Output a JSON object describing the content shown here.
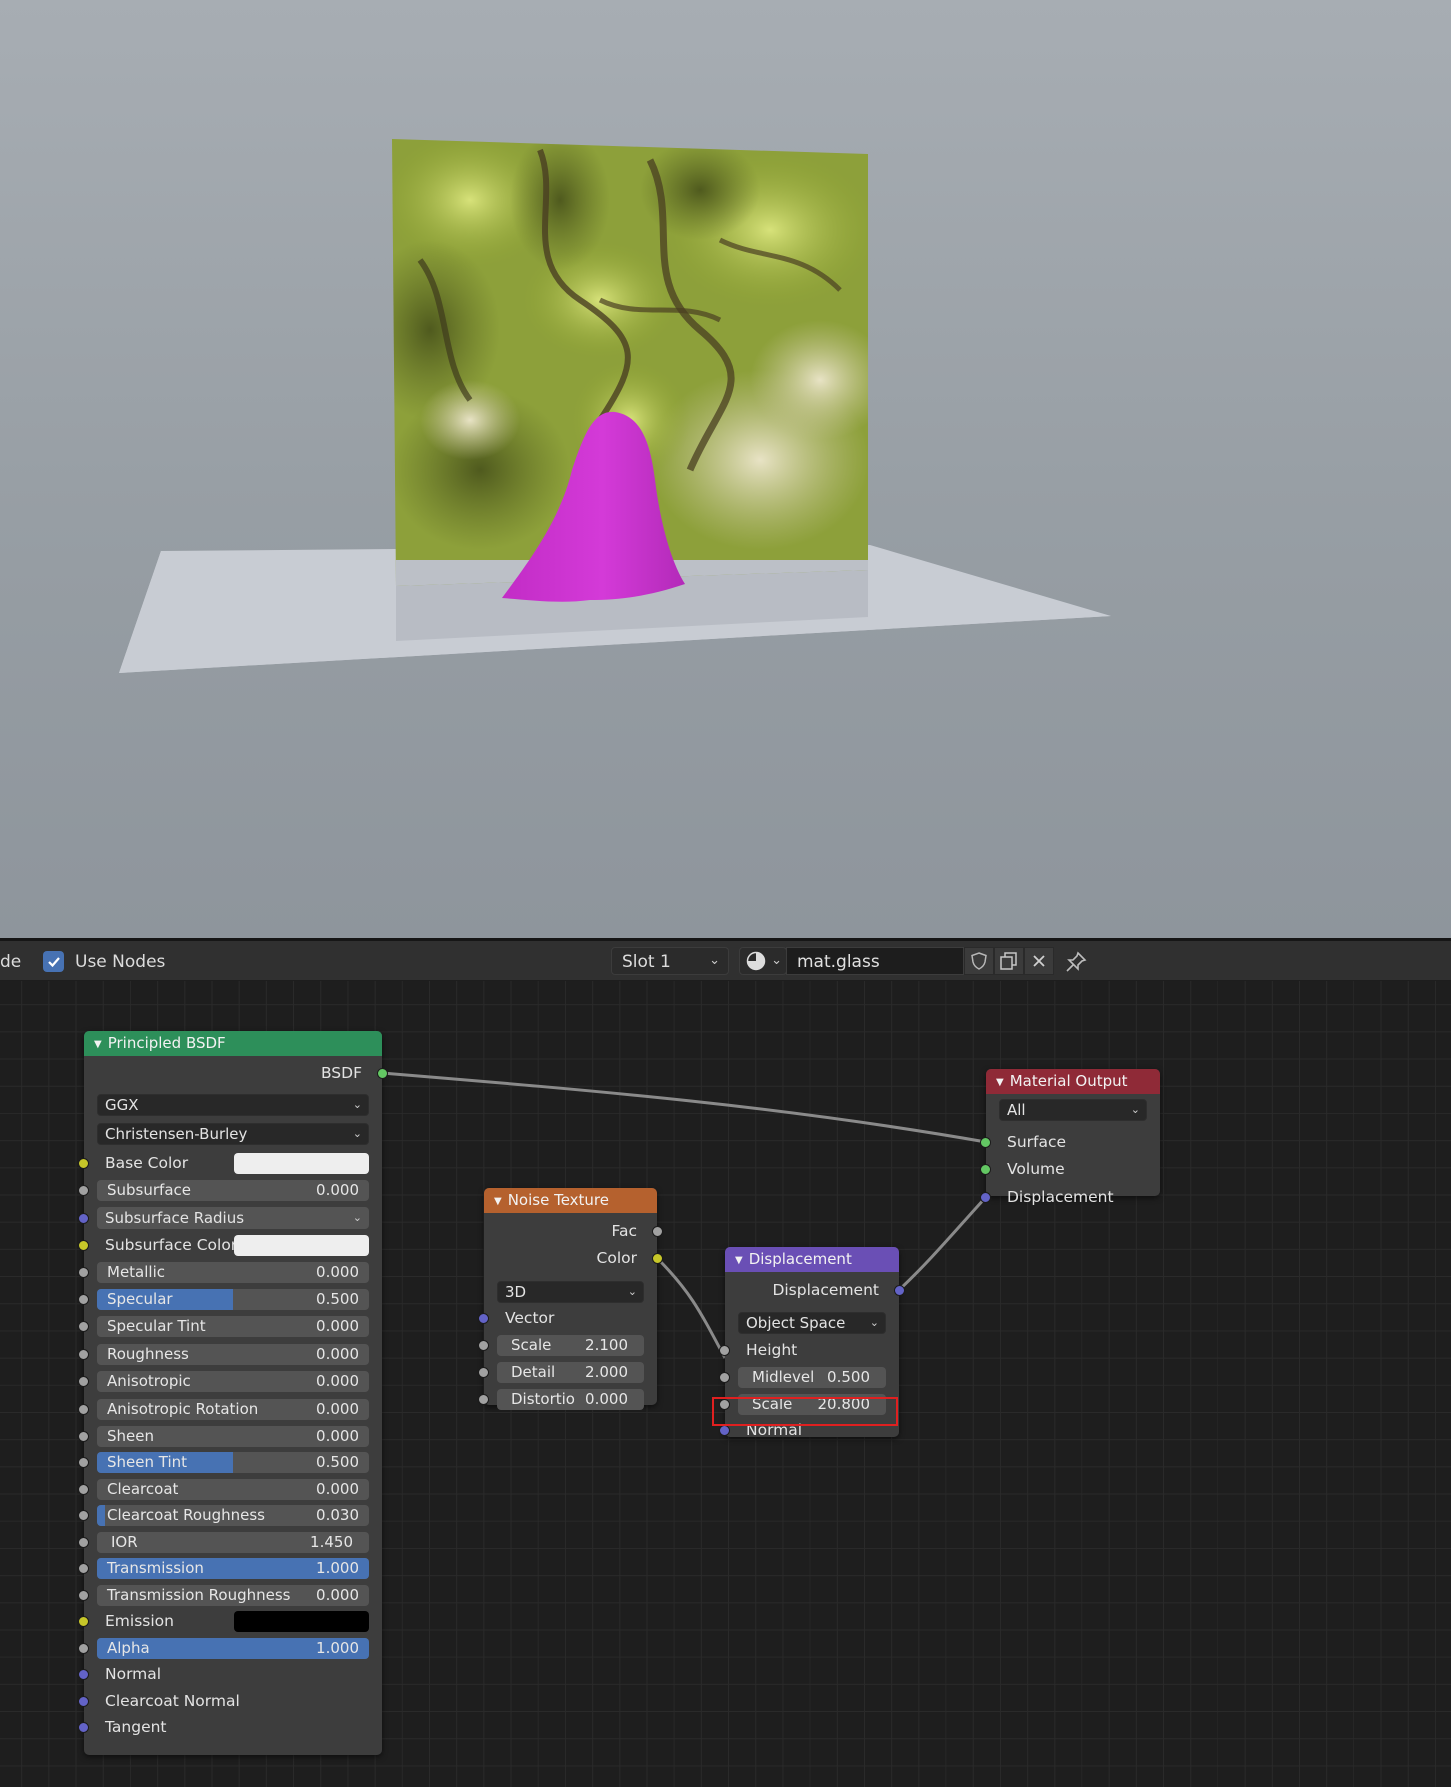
{
  "header": {
    "mode_fragment": "de",
    "use_nodes_label": "Use Nodes",
    "use_nodes_checked": true,
    "slot": "Slot 1",
    "material_name": "mat.glass"
  },
  "nodes": {
    "principled": {
      "title": "Principled BSDF",
      "color": "#2d8f5a",
      "output": "BSDF",
      "distribution": "GGX",
      "subsurface_method": "Christensen-Burley",
      "base_color_label": "Base Color",
      "base_color_value": "#eeeeee",
      "subsurface": {
        "label": "Subsurface",
        "value": "0.000"
      },
      "subsurface_radius": "Subsurface Radius",
      "subsurface_color_label": "Subsurface Color",
      "subsurface_color_value": "#eeeeee",
      "metallic": {
        "label": "Metallic",
        "value": "0.000"
      },
      "specular": {
        "label": "Specular",
        "value": "0.500",
        "fraction": 0.5
      },
      "specular_tint": {
        "label": "Specular Tint",
        "value": "0.000"
      },
      "roughness": {
        "label": "Roughness",
        "value": "0.000"
      },
      "anisotropic": {
        "label": "Anisotropic",
        "value": "0.000"
      },
      "anisotropic_rotation": {
        "label": "Anisotropic Rotation",
        "value": "0.000"
      },
      "sheen": {
        "label": "Sheen",
        "value": "0.000"
      },
      "sheen_tint": {
        "label": "Sheen Tint",
        "value": "0.500",
        "fraction": 0.5
      },
      "clearcoat": {
        "label": "Clearcoat",
        "value": "0.000"
      },
      "clearcoat_roughness": {
        "label": "Clearcoat Roughness",
        "value": "0.030",
        "fraction": 0.03
      },
      "ior": {
        "label": "IOR",
        "value": "1.450"
      },
      "transmission": {
        "label": "Transmission",
        "value": "1.000",
        "fraction": 1.0
      },
      "transmission_roughness": {
        "label": "Transmission Roughness",
        "value": "0.000"
      },
      "emission_label": "Emission",
      "emission_value": "#000000",
      "alpha": {
        "label": "Alpha",
        "value": "1.000",
        "fraction": 1.0
      },
      "normal": "Normal",
      "clearcoat_normal": "Clearcoat Normal",
      "tangent": "Tangent"
    },
    "noise": {
      "title": "Noise Texture",
      "color": "#b5612e",
      "out_fac": "Fac",
      "out_color": "Color",
      "dimensions": "3D",
      "vector": "Vector",
      "scale": {
        "label": "Scale",
        "value": "2.100"
      },
      "detail": {
        "label": "Detail",
        "value": "2.000"
      },
      "distortion": {
        "label": "Distortio",
        "value": "0.000"
      }
    },
    "displacement": {
      "title": "Displacement",
      "color": "#6a4fb5",
      "output": "Displacement",
      "space": "Object Space",
      "height": "Height",
      "midlevel": {
        "label": "Midlevel",
        "value": "0.500"
      },
      "scale": {
        "label": "Scale",
        "value": "20.800"
      },
      "normal": "Normal"
    },
    "output": {
      "title": "Material Output",
      "color": "#8f2a37",
      "target": "All",
      "surface": "Surface",
      "volume": "Volume",
      "displacement": "Displacement"
    }
  },
  "accent_color": "#4772b3",
  "highlight_color": "#e02020"
}
